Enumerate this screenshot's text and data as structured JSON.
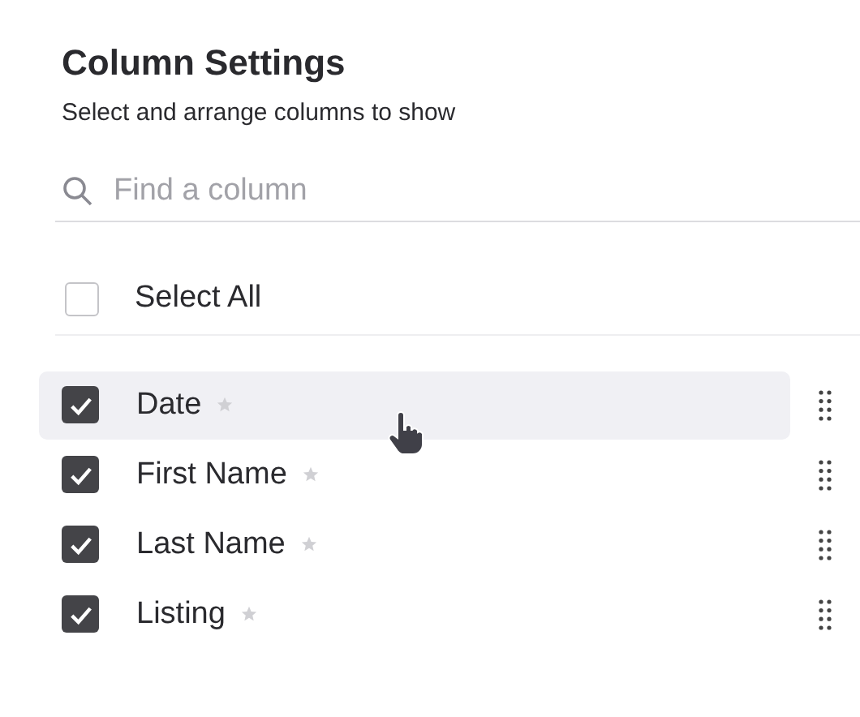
{
  "title": "Column Settings",
  "subtitle": "Select and arrange columns to show",
  "search": {
    "placeholder": "Find a column"
  },
  "select_all": {
    "label": "Select All",
    "checked": false
  },
  "columns": [
    {
      "label": "Date",
      "checked": true,
      "hovered": true
    },
    {
      "label": "First Name",
      "checked": true,
      "hovered": false
    },
    {
      "label": "Last Name",
      "checked": true,
      "hovered": false
    },
    {
      "label": "Listing",
      "checked": true,
      "hovered": false
    }
  ]
}
